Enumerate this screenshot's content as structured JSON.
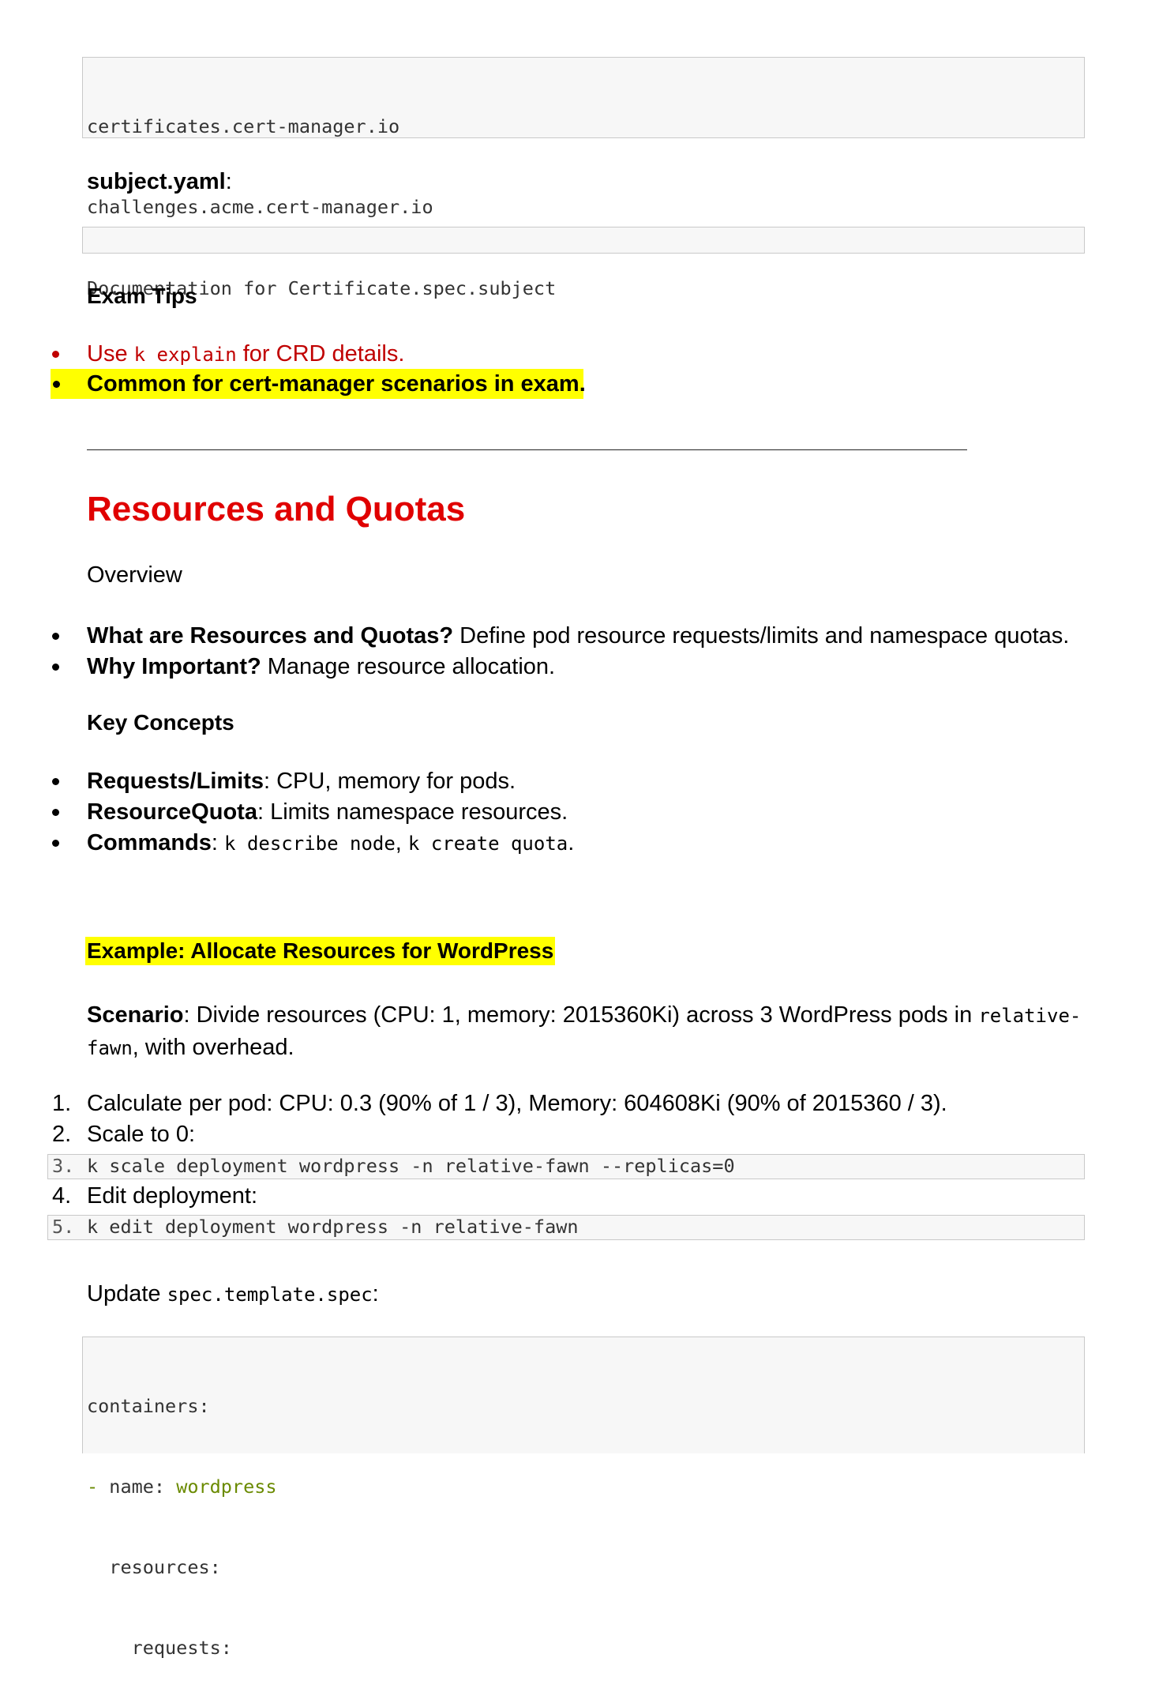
{
  "code_block_1": {
    "lines": [
      "certificates.cert-manager.io",
      "challenges.acme.cert-manager.io",
      "..."
    ]
  },
  "subject_heading": {
    "bold": "subject.yaml",
    "suffix": ":"
  },
  "code_block_2": {
    "lines": [
      "Documentation for Certificate.spec.subject"
    ]
  },
  "exam_tips": {
    "heading": "Exam Tips",
    "tip1": {
      "prefix": "Use ",
      "code": "k explain",
      "suffix": " for CRD details."
    },
    "tip2": "Common for cert-manager scenarios in exam."
  },
  "section": {
    "title": "Resources and Quotas",
    "overview_heading": "Overview",
    "overview_bullets": [
      {
        "bold": "What are Resources and Quotas?",
        "text": " Define pod resource requests/limits and namespace quotas."
      },
      {
        "bold": "Why Important?",
        "text": " Manage resource allocation."
      }
    ],
    "key_concepts_heading": "Key Concepts",
    "key_concepts": [
      {
        "bold": "Requests/Limits",
        "text": ": CPU, memory for pods."
      },
      {
        "bold": "ResourceQuota",
        "text": ": Limits namespace resources."
      }
    ],
    "commands": {
      "bold": "Commands",
      "sep": ": ",
      "code1": "k describe node",
      "comma": ", ",
      "code2": "k create quota",
      "end": "."
    }
  },
  "example": {
    "heading": "Example: Allocate Resources for WordPress",
    "scenario": {
      "bold": "Scenario",
      "text": ": Divide resources (CPU: 1, memory: 2015360Ki) across 3 WordPress pods in ",
      "code_part1": "relative-",
      "code_part2": "fawn",
      "text2": ", with overhead."
    },
    "steps": [
      {
        "num": "1.",
        "text": "Calculate per pod: CPU: 0.3 (90% of 1 / 3), Memory: 604608Ki (90% of 2015360 / 3)."
      },
      {
        "num": "2.",
        "text": "Scale to 0:"
      },
      {
        "num": "3.",
        "code": "k scale deployment wordpress -n relative-fawn --replicas=0"
      },
      {
        "num": "4.",
        "text": "Edit deployment:"
      },
      {
        "num": "5.",
        "code": "k edit deployment wordpress -n relative-fawn"
      }
    ],
    "update": {
      "prefix": "Update ",
      "code": "spec.template.spec",
      "suffix": ":"
    },
    "yaml": {
      "line1": "containers:",
      "line2_dash": "- ",
      "line2_key": "name: ",
      "line2_val": "wordpress",
      "line3": "  resources:",
      "line4": "    requests:"
    }
  },
  "colors": {
    "heading_red": "#e00000",
    "tip_red": "#c00000",
    "highlight": "#ffff00",
    "yaml_green": "#6a8a00",
    "code_bg": "#f7f7f7"
  }
}
